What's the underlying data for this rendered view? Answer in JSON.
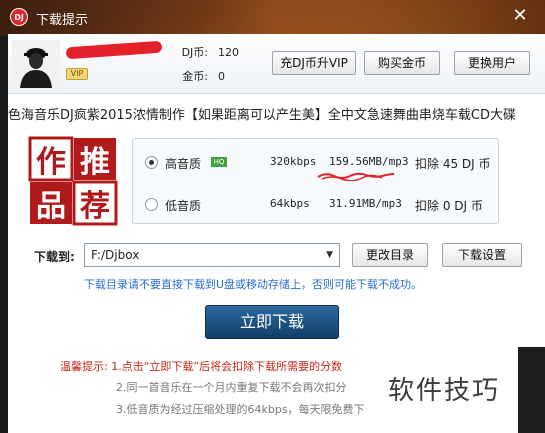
{
  "window": {
    "title": "下载提示",
    "icon_text": "DJ",
    "close": "✕"
  },
  "user": {
    "vip_label": "VIP",
    "dj_coin_label": "DJ币:",
    "dj_coin_value": "120",
    "gold_label": "金币:",
    "gold_value": "0"
  },
  "top_buttons": {
    "recharge": "充DJ币升VIP",
    "buy_gold": "购买金币",
    "switch_user": "更换用户"
  },
  "song_title": "色海音乐DJ疯紫2015浓情制作【如果距离可以产生美】全中文急速舞曲串烧车载CD大碟",
  "promo": {
    "chars": [
      "作",
      "推",
      "品",
      "荐"
    ]
  },
  "quality": {
    "high": {
      "name": "高音质",
      "badge": "HQ",
      "bitrate": "320kbps",
      "size": "159.56MB/mp3",
      "cost": "扣除 45 DJ 币",
      "selected": true
    },
    "low": {
      "name": "低音质",
      "bitrate": "64kbps",
      "size": "31.91MB/mp3",
      "cost": "扣除 0 DJ 币",
      "selected": false
    }
  },
  "download": {
    "label": "下载到:",
    "path": "F:/Djbox",
    "change_dir": "更改目录",
    "settings": "下载设置",
    "warning": "下载目录请不要直接下载到U盘或移动存储上，否则可能下载不成功。",
    "submit": "立即下载"
  },
  "tips": {
    "heading": "温馨提示:",
    "line1": "1.点击“立即下载”后将会扣除下载所需要的分数",
    "line2": "2.同一首音乐在一个月内重复下载不会再次扣分",
    "line3": "3.低音质为经过压缩处理的64kbps，每天限免费下"
  },
  "watermark": "软件技巧",
  "colors": {
    "accent_blue": "#1a4f80",
    "tip_red": "#c9261a",
    "warning_blue": "#2a6fd0",
    "redaction_red": "#e4202a"
  }
}
